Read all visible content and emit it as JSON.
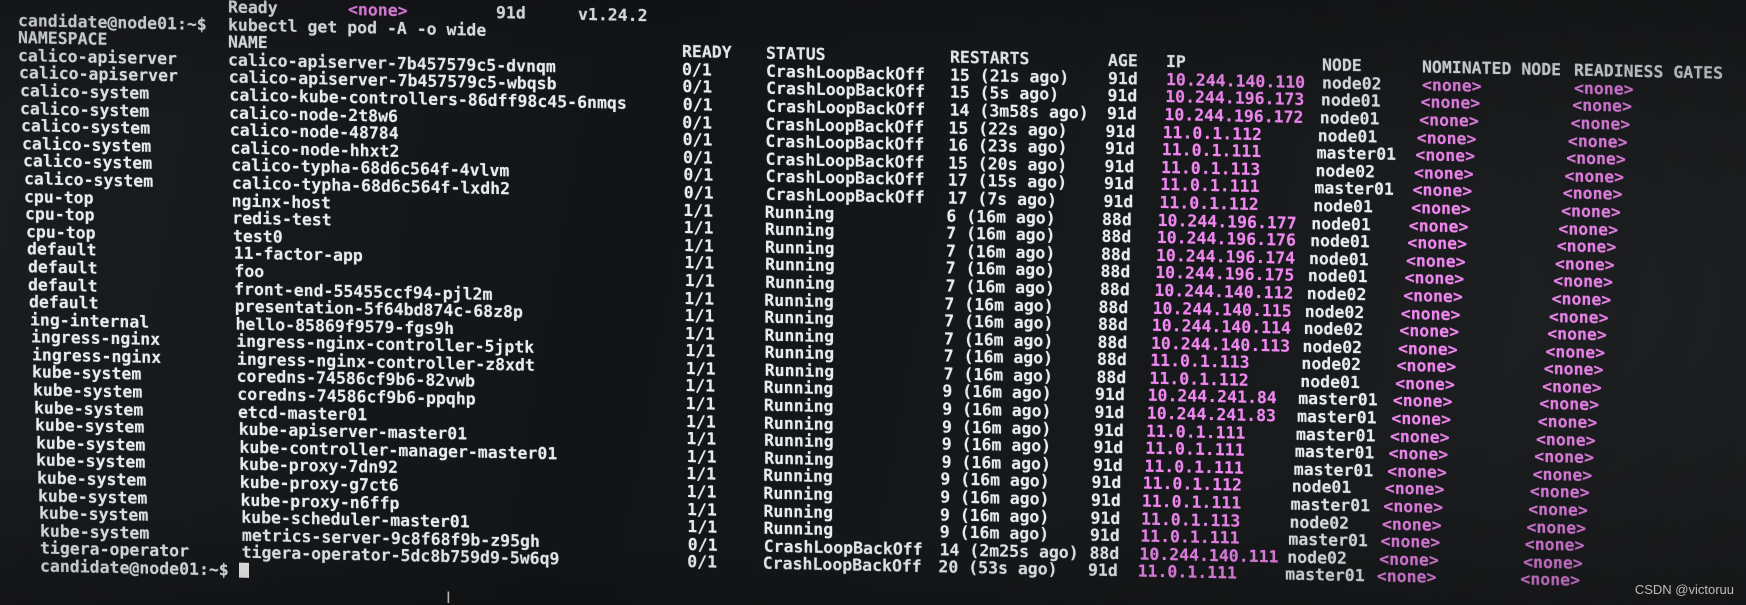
{
  "terminal": {
    "prev_line": {
      "ns": "",
      "name": "Ready",
      "extra": "<none>",
      "age": "91d",
      "version": "v1.24.2"
    },
    "prompt": "candidate@node01:~$",
    "command": "kubectl get pod -A -o wide",
    "headers": {
      "namespace": "NAMESPACE",
      "name": "NAME",
      "ready": "READY",
      "status": "STATUS",
      "restarts": "RESTARTS",
      "age": "AGE",
      "ip": "IP",
      "node": "NODE",
      "nominated_node": "NOMINATED NODE",
      "readiness_gates": "READINESS GATES"
    },
    "rows": [
      {
        "ns": "calico-apiserver",
        "name": "calico-apiserver-7b457579c5-dvnqm",
        "ready": "0/1",
        "status": "CrashLoopBackOff",
        "restarts": "15 (21s ago)",
        "age": "91d",
        "ip": "10.244.140.110",
        "node": "node02",
        "nom": "<none>",
        "gates": "<none>"
      },
      {
        "ns": "calico-apiserver",
        "name": "calico-apiserver-7b457579c5-wbqsb",
        "ready": "0/1",
        "status": "CrashLoopBackOff",
        "restarts": "15 (5s ago)",
        "age": "91d",
        "ip": "10.244.196.173",
        "node": "node01",
        "nom": "<none>",
        "gates": "<none>"
      },
      {
        "ns": "calico-system",
        "name": "calico-kube-controllers-86dff98c45-6nmqs",
        "ready": "0/1",
        "status": "CrashLoopBackOff",
        "restarts": "14 (3m58s ago)",
        "age": "91d",
        "ip": "10.244.196.172",
        "node": "node01",
        "nom": "<none>",
        "gates": "<none>"
      },
      {
        "ns": "calico-system",
        "name": "calico-node-2t8w6",
        "ready": "0/1",
        "status": "CrashLoopBackOff",
        "restarts": "15 (22s ago)",
        "age": "91d",
        "ip": "11.0.1.112",
        "node": "node01",
        "nom": "<none>",
        "gates": "<none>"
      },
      {
        "ns": "calico-system",
        "name": "calico-node-48784",
        "ready": "0/1",
        "status": "CrashLoopBackOff",
        "restarts": "16 (23s ago)",
        "age": "91d",
        "ip": "11.0.1.111",
        "node": "master01",
        "nom": "<none>",
        "gates": "<none>"
      },
      {
        "ns": "calico-system",
        "name": "calico-node-hhxt2",
        "ready": "0/1",
        "status": "CrashLoopBackOff",
        "restarts": "15 (20s ago)",
        "age": "91d",
        "ip": "11.0.1.113",
        "node": "node02",
        "nom": "<none>",
        "gates": "<none>"
      },
      {
        "ns": "calico-system",
        "name": "calico-typha-68d6c564f-4vlvm",
        "ready": "0/1",
        "status": "CrashLoopBackOff",
        "restarts": "17 (15s ago)",
        "age": "91d",
        "ip": "11.0.1.111",
        "node": "master01",
        "nom": "<none>",
        "gates": "<none>"
      },
      {
        "ns": "calico-system",
        "name": "calico-typha-68d6c564f-lxdh2",
        "ready": "0/1",
        "status": "CrashLoopBackOff",
        "restarts": "17 (7s ago)",
        "age": "91d",
        "ip": "11.0.1.112",
        "node": "node01",
        "nom": "<none>",
        "gates": "<none>"
      },
      {
        "ns": "cpu-top",
        "name": "nginx-host",
        "ready": "1/1",
        "status": "Running",
        "restarts": "6 (16m ago)",
        "age": "88d",
        "ip": "10.244.196.177",
        "node": "node01",
        "nom": "<none>",
        "gates": "<none>"
      },
      {
        "ns": "cpu-top",
        "name": "redis-test",
        "ready": "1/1",
        "status": "Running",
        "restarts": "7 (16m ago)",
        "age": "88d",
        "ip": "10.244.196.176",
        "node": "node01",
        "nom": "<none>",
        "gates": "<none>"
      },
      {
        "ns": "cpu-top",
        "name": "test0",
        "ready": "1/1",
        "status": "Running",
        "restarts": "7 (16m ago)",
        "age": "88d",
        "ip": "10.244.196.174",
        "node": "node01",
        "nom": "<none>",
        "gates": "<none>"
      },
      {
        "ns": "default",
        "name": "11-factor-app",
        "ready": "1/1",
        "status": "Running",
        "restarts": "7 (16m ago)",
        "age": "88d",
        "ip": "10.244.196.175",
        "node": "node01",
        "nom": "<none>",
        "gates": "<none>"
      },
      {
        "ns": "default",
        "name": "foo",
        "ready": "1/1",
        "status": "Running",
        "restarts": "7 (16m ago)",
        "age": "88d",
        "ip": "10.244.140.112",
        "node": "node02",
        "nom": "<none>",
        "gates": "<none>"
      },
      {
        "ns": "default",
        "name": "front-end-55455ccf94-pjl2m",
        "ready": "1/1",
        "status": "Running",
        "restarts": "7 (16m ago)",
        "age": "88d",
        "ip": "10.244.140.115",
        "node": "node02",
        "nom": "<none>",
        "gates": "<none>"
      },
      {
        "ns": "default",
        "name": "presentation-5f64bd874c-68z8p",
        "ready": "1/1",
        "status": "Running",
        "restarts": "7 (16m ago)",
        "age": "88d",
        "ip": "10.244.140.114",
        "node": "node02",
        "nom": "<none>",
        "gates": "<none>"
      },
      {
        "ns": "ing-internal",
        "name": "hello-85869f9579-fgs9h",
        "ready": "1/1",
        "status": "Running",
        "restarts": "7 (16m ago)",
        "age": "88d",
        "ip": "10.244.140.113",
        "node": "node02",
        "nom": "<none>",
        "gates": "<none>"
      },
      {
        "ns": "ingress-nginx",
        "name": "ingress-nginx-controller-5jptk",
        "ready": "1/1",
        "status": "Running",
        "restarts": "7 (16m ago)",
        "age": "88d",
        "ip": "11.0.1.113",
        "node": "node02",
        "nom": "<none>",
        "gates": "<none>"
      },
      {
        "ns": "ingress-nginx",
        "name": "ingress-nginx-controller-z8xdt",
        "ready": "1/1",
        "status": "Running",
        "restarts": "7 (16m ago)",
        "age": "88d",
        "ip": "11.0.1.112",
        "node": "node01",
        "nom": "<none>",
        "gates": "<none>"
      },
      {
        "ns": "kube-system",
        "name": "coredns-74586cf9b6-82vwb",
        "ready": "1/1",
        "status": "Running",
        "restarts": "9 (16m ago)",
        "age": "91d",
        "ip": "10.244.241.84",
        "node": "master01",
        "nom": "<none>",
        "gates": "<none>"
      },
      {
        "ns": "kube-system",
        "name": "coredns-74586cf9b6-ppqhp",
        "ready": "1/1",
        "status": "Running",
        "restarts": "9 (16m ago)",
        "age": "91d",
        "ip": "10.244.241.83",
        "node": "master01",
        "nom": "<none>",
        "gates": "<none>"
      },
      {
        "ns": "kube-system",
        "name": "etcd-master01",
        "ready": "1/1",
        "status": "Running",
        "restarts": "9 (16m ago)",
        "age": "91d",
        "ip": "11.0.1.111",
        "node": "master01",
        "nom": "<none>",
        "gates": "<none>"
      },
      {
        "ns": "kube-system",
        "name": "kube-apiserver-master01",
        "ready": "1/1",
        "status": "Running",
        "restarts": "9 (16m ago)",
        "age": "91d",
        "ip": "11.0.1.111",
        "node": "master01",
        "nom": "<none>",
        "gates": "<none>"
      },
      {
        "ns": "kube-system",
        "name": "kube-controller-manager-master01",
        "ready": "1/1",
        "status": "Running",
        "restarts": "9 (16m ago)",
        "age": "91d",
        "ip": "11.0.1.111",
        "node": "master01",
        "nom": "<none>",
        "gates": "<none>"
      },
      {
        "ns": "kube-system",
        "name": "kube-proxy-7dn92",
        "ready": "1/1",
        "status": "Running",
        "restarts": "9 (16m ago)",
        "age": "91d",
        "ip": "11.0.1.112",
        "node": "node01",
        "nom": "<none>",
        "gates": "<none>"
      },
      {
        "ns": "kube-system",
        "name": "kube-proxy-g7ct6",
        "ready": "1/1",
        "status": "Running",
        "restarts": "9 (16m ago)",
        "age": "91d",
        "ip": "11.0.1.111",
        "node": "master01",
        "nom": "<none>",
        "gates": "<none>"
      },
      {
        "ns": "kube-system",
        "name": "kube-proxy-n6ffp",
        "ready": "1/1",
        "status": "Running",
        "restarts": "9 (16m ago)",
        "age": "91d",
        "ip": "11.0.1.113",
        "node": "node02",
        "nom": "<none>",
        "gates": "<none>"
      },
      {
        "ns": "kube-system",
        "name": "kube-scheduler-master01",
        "ready": "1/1",
        "status": "Running",
        "restarts": "9 (16m ago)",
        "age": "91d",
        "ip": "11.0.1.111",
        "node": "master01",
        "nom": "<none>",
        "gates": "<none>"
      },
      {
        "ns": "kube-system",
        "name": "metrics-server-9c8f68f9b-z95gh",
        "ready": "0/1",
        "status": "CrashLoopBackOff",
        "restarts": "14 (2m25s ago)",
        "age": "88d",
        "ip": "10.244.140.111",
        "node": "node02",
        "nom": "<none>",
        "gates": "<none>"
      },
      {
        "ns": "tigera-operator",
        "name": "tigera-operator-5dc8b759d9-5w6q9",
        "ready": "0/1",
        "status": "CrashLoopBackOff",
        "restarts": "20 (53s ago)",
        "age": "91d",
        "ip": "11.0.1.111",
        "node": "master01",
        "nom": "<none>",
        "gates": "<none>"
      }
    ]
  },
  "watermark": "CSDN @victoruu",
  "colors": {
    "background": "#141618",
    "text": "#e9ecef",
    "highlight": "#ee88ee"
  }
}
